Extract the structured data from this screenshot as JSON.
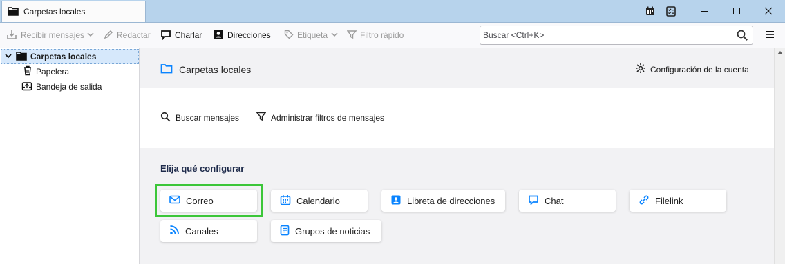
{
  "tab": {
    "title": "Carpetas locales"
  },
  "window_controls": {
    "icons": [
      "calendar-icon",
      "tasks-icon",
      "minimize-icon",
      "maximize-icon",
      "close-icon"
    ]
  },
  "toolbar": {
    "get_messages": "Recibir mensajes",
    "compose": "Redactar",
    "chat": "Charlar",
    "address_book": "Direcciones",
    "tag": "Etiqueta",
    "quick_filter": "Filtro rápido",
    "search_placeholder": "Buscar <Ctrl+K>"
  },
  "sidebar": {
    "root": "Carpetas locales",
    "items": [
      {
        "label": "Papelera",
        "icon": "trash-icon"
      },
      {
        "label": "Bandeja de salida",
        "icon": "outbox-icon"
      }
    ]
  },
  "account_header": {
    "title": "Carpetas locales",
    "settings": "Configuración de la cuenta"
  },
  "actions": {
    "search_messages": "Buscar mensajes",
    "manage_filters": "Administrar filtros de mensajes"
  },
  "setup": {
    "title": "Elija qué configurar",
    "cards": [
      {
        "label": "Correo",
        "icon": "mail-icon"
      },
      {
        "label": "Calendario",
        "icon": "calendar-icon"
      },
      {
        "label": "Libreta de direcciones",
        "icon": "address-book-icon"
      },
      {
        "label": "Chat",
        "icon": "chat-icon"
      },
      {
        "label": "Filelink",
        "icon": "link-icon"
      },
      {
        "label": "Canales",
        "icon": "rss-icon"
      },
      {
        "label": "Grupos de noticias",
        "icon": "newsgroup-icon"
      }
    ]
  },
  "colors": {
    "accent": "#0060df",
    "focus": "#3cc639",
    "titlebar": "#b7d3ec"
  }
}
